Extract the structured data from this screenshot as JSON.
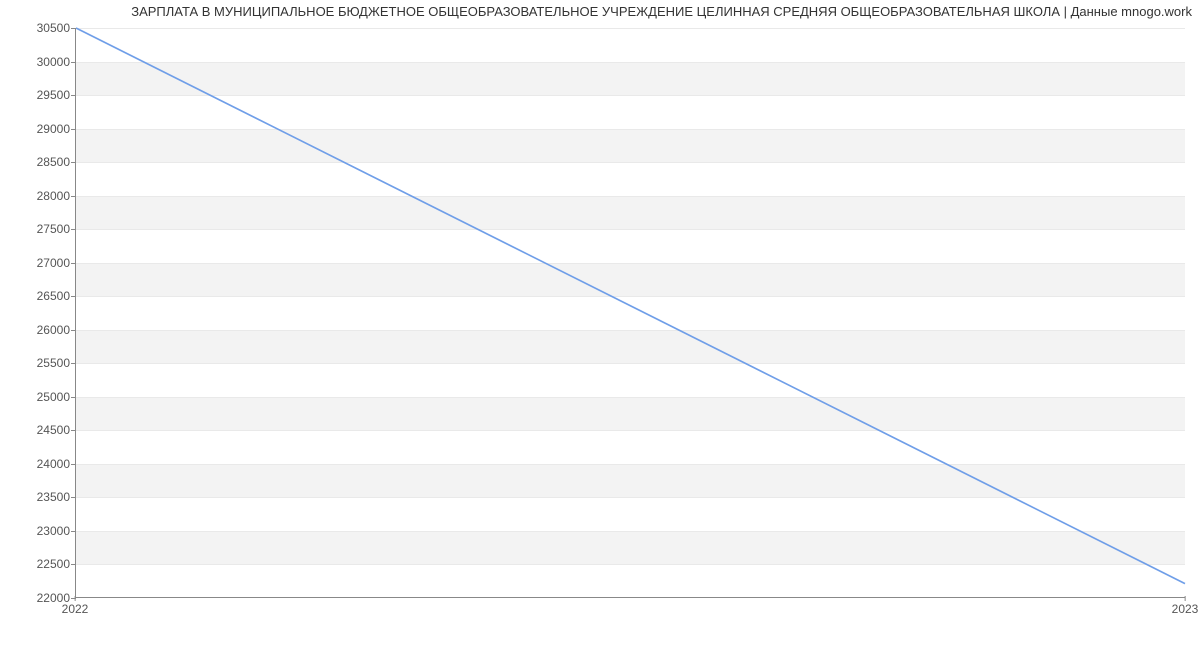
{
  "title": "ЗАРПЛАТА В МУНИЦИПАЛЬНОЕ БЮДЖЕТНОЕ ОБЩЕОБРАЗОВАТЕЛЬНОЕ УЧРЕЖДЕНИЕ ЦЕЛИННАЯ СРЕДНЯЯ ОБЩЕОБРАЗОВАТЕЛЬНАЯ ШКОЛА | Данные mnogo.work",
  "chart_data": {
    "type": "line",
    "x": [
      "2022",
      "2023"
    ],
    "series": [
      {
        "name": "Зарплата",
        "values": [
          30500,
          22200
        ],
        "color": "#6f9ee8"
      }
    ],
    "xlabel": "",
    "ylabel": "",
    "ylim": [
      22000,
      30500
    ],
    "yticks": [
      22000,
      22500,
      23000,
      23500,
      24000,
      24500,
      25000,
      25500,
      26000,
      26500,
      27000,
      27500,
      28000,
      28500,
      29000,
      29500,
      30000,
      30500
    ],
    "xticks": [
      "2022",
      "2023"
    ],
    "grid": true,
    "legend": false
  }
}
